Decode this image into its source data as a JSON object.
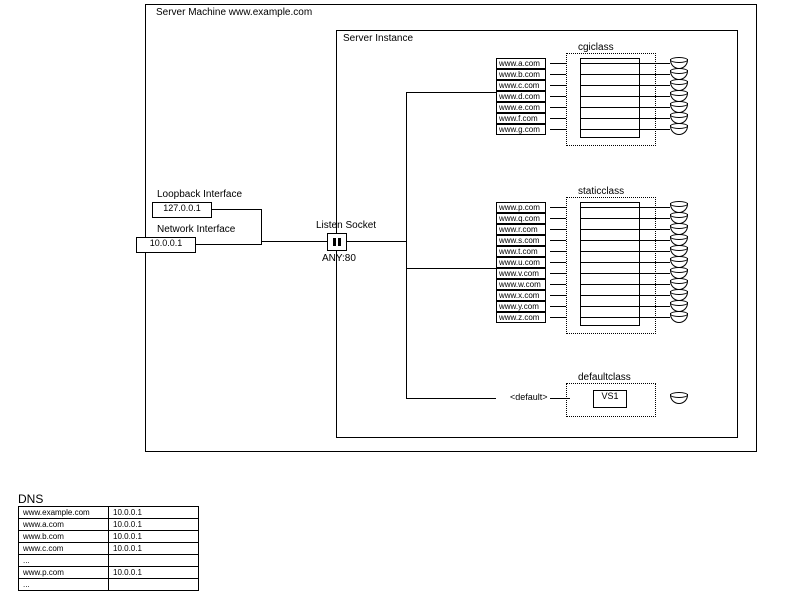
{
  "server_machine": {
    "title": "Server Machine www.example.com",
    "loopback_label": "Loopback Interface",
    "loopback_ip": "127.0.0.1",
    "network_label": "Network Interface",
    "network_ip": "10.0.0.1"
  },
  "server_instance": {
    "title": "Server Instance",
    "listen_socket_label": "Listen Socket",
    "listen_addr": "ANY:80"
  },
  "classes": {
    "cgi": {
      "label": "cgiclass",
      "hosts": [
        "www.a.com",
        "www.b.com",
        "www.c.com",
        "www.d.com",
        "www.e.com",
        "www.f.com",
        "www.g.com"
      ]
    },
    "static": {
      "label": "staticclass",
      "hosts": [
        "www.p.com",
        "www.q.com",
        "www.r.com",
        "www.s.com",
        "www.t.com",
        "www.u.com",
        "www.v.com",
        "www.w.com",
        "www.x.com",
        "www.y.com",
        "www.z.com"
      ]
    },
    "default": {
      "label": "defaultclass",
      "host_label": "<default>",
      "vs_label": "VS1"
    }
  },
  "dns": {
    "title": "DNS",
    "rows": [
      {
        "host": "www.example.com",
        "ip": "10.0.0.1"
      },
      {
        "host": "www.a.com",
        "ip": "10.0.0.1"
      },
      {
        "host": "www.b.com",
        "ip": "10.0.0.1"
      },
      {
        "host": "www.c.com",
        "ip": "10.0.0.1"
      },
      {
        "host": "...",
        "ip": ""
      },
      {
        "host": "www.p.com",
        "ip": "10.0.0.1"
      },
      {
        "host": "...",
        "ip": ""
      }
    ]
  }
}
